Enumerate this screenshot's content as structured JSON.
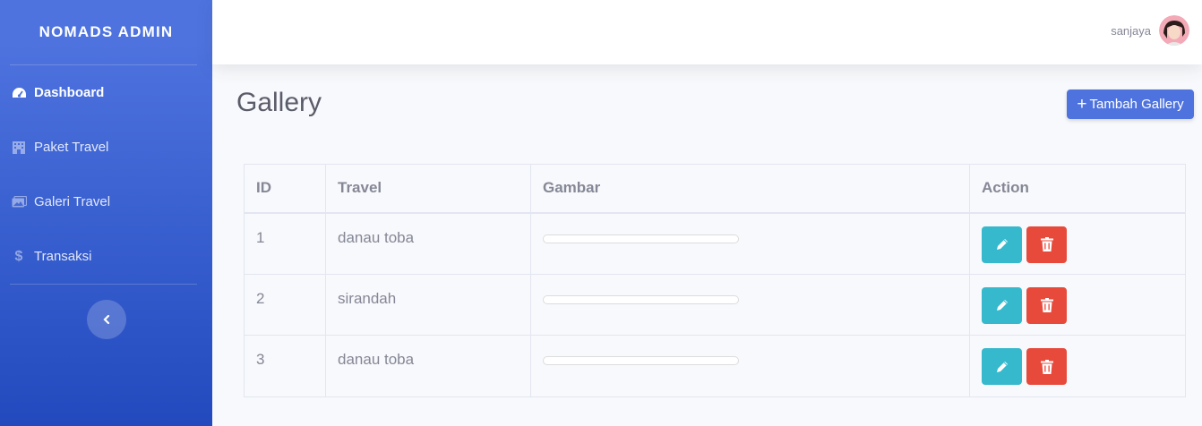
{
  "sidebar": {
    "brand": "NOMADS ADMIN",
    "items": [
      {
        "label": "Dashboard",
        "icon": "dashboard-icon",
        "active": true
      },
      {
        "label": "Paket Travel",
        "icon": "building-icon",
        "active": false
      },
      {
        "label": "Galeri Travel",
        "icon": "images-icon",
        "active": false
      },
      {
        "label": "Transaksi",
        "icon": "dollar-icon",
        "active": false
      }
    ]
  },
  "topbar": {
    "user_name": "sanjaya"
  },
  "main": {
    "title": "Gallery",
    "add_button": "Tambah Gallery",
    "table": {
      "headers": [
        "ID",
        "Travel",
        "Gambar",
        "Action"
      ],
      "rows": [
        {
          "id": "1",
          "travel": "danau toba"
        },
        {
          "id": "2",
          "travel": "sirandah"
        },
        {
          "id": "3",
          "travel": "danau toba"
        }
      ]
    }
  },
  "colors": {
    "primary": "#4e73df",
    "info": "#36b9cc",
    "danger": "#e74a3b",
    "text": "#858796"
  }
}
